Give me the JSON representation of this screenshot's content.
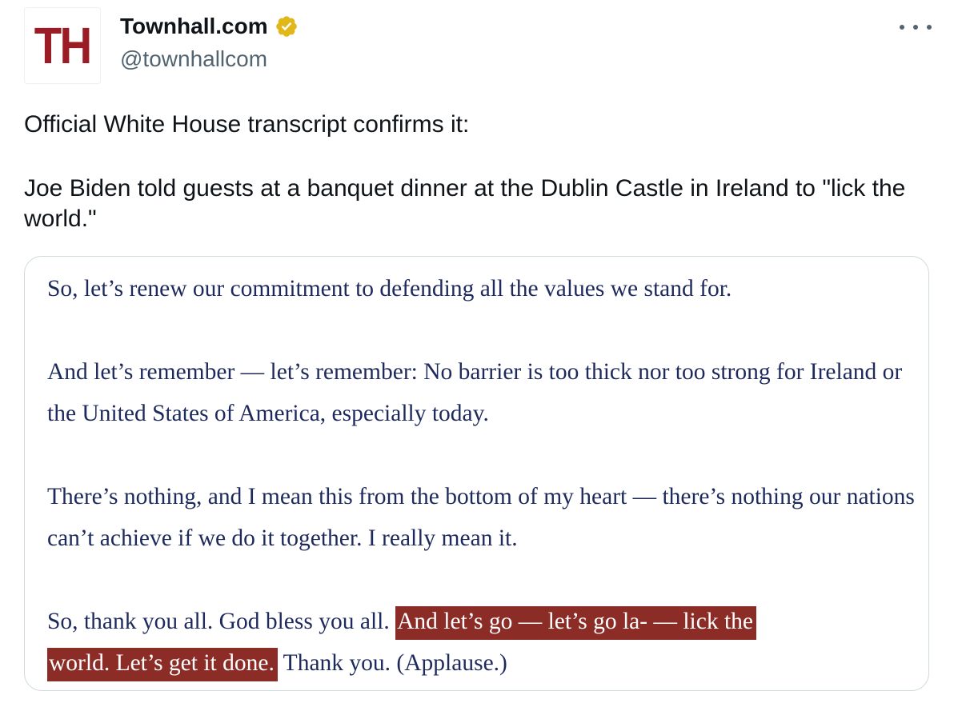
{
  "author": {
    "avatar_text": "TH",
    "display_name": "Townhall.com",
    "handle": "@townhallcom",
    "verified_badge_icon": "verified-badge-icon",
    "verified_color": "#e2b719"
  },
  "menu": {
    "icon": "more-options-icon"
  },
  "tweet": {
    "line1": "Official White House transcript confirms it:",
    "line2": "Joe Biden told guests at a banquet dinner at the Dublin Castle in Ireland to \"lick the world.\""
  },
  "transcript": {
    "p1": "So, let’s renew our commitment to defending all the values we stand for.",
    "p2": "And let’s remember — let’s remember: No barrier is too thick nor too strong for Ireland or the United States of America, especially today.",
    "p3": "There’s nothing, and I mean this from the bottom of my heart — there’s nothing our nations can’t achieve if we do it together.  I really mean it.",
    "p4_before": "So, thank you all.  God bless you all.  ",
    "p4_highlight_1": "And let’s go — let’s go la- — lick the",
    "p4_highlight_2": "world.  Let’s get it done.",
    "p4_after": "  Thank you.  (Applause.)",
    "text_color": "#1f2a5c",
    "highlight_color": "#8c2c26"
  }
}
